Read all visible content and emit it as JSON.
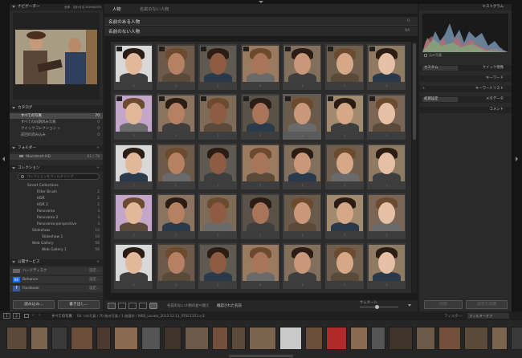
{
  "left_panel": {
    "navigator": {
      "title": "ナビゲーター",
      "modes": [
        "全体",
        "合わせる",
        "100%",
        "300%"
      ]
    },
    "catalog": {
      "title": "カタログ",
      "items": [
        {
          "label": "すべての写真",
          "count": "70",
          "selected": true
        },
        {
          "label": "すべての同期済み写真",
          "count": "0"
        },
        {
          "label": "クイックコレクション +",
          "count": "0"
        },
        {
          "label": "前回の読み込み",
          "count": "0"
        }
      ]
    },
    "folders": {
      "title": "フォルダー",
      "drive": {
        "label": "Macintosh HD",
        "size": "61 / 78"
      }
    },
    "collections": {
      "title": "コレクション",
      "filter_placeholder": "コレクションをフィルタリング",
      "items": [
        {
          "label": "Smart Collections",
          "count": ""
        },
        {
          "label": "Filter Brush",
          "count": "2"
        },
        {
          "label": "HDR",
          "count": "2"
        },
        {
          "label": "HDR 2",
          "count": "2"
        },
        {
          "label": "Panorama",
          "count": "3"
        },
        {
          "label": "Panorama 2",
          "count": "3"
        },
        {
          "label": "Panorama-perspective",
          "count": "3"
        },
        {
          "label": "Slideshow",
          "count": "10"
        },
        {
          "label": "Slideshow 1",
          "count": "16"
        },
        {
          "label": "Web Gallery",
          "count": "56"
        },
        {
          "label": "Web Gallery 1",
          "count": "56"
        }
      ]
    },
    "publish": {
      "title": "公開サービス",
      "items": [
        {
          "label": "ハードディスク",
          "action": "設定..."
        },
        {
          "label": "Behance",
          "action": "設定..."
        },
        {
          "label": "Facebook",
          "action": "設定..."
        }
      ]
    },
    "import_button": "読み込み...",
    "export_button": "書き出し..."
  },
  "center": {
    "tabs": [
      "人物",
      "名前のない人物"
    ],
    "header1": {
      "label": "名前のある人物",
      "count": "0"
    },
    "header2": {
      "label": "名前のない人物",
      "count": "64"
    },
    "toolbar": {
      "sort_label": "名前のない人物の並べ替え",
      "sort_value": "確認された名前",
      "thumb_label": "サムネール"
    }
  },
  "right_panel": {
    "histogram_title": "ヒストグラム",
    "info": [
      "ISO 800",
      "55 mm",
      "f / 5.6",
      "1/160 秒"
    ],
    "original_photo": "元の写真",
    "quick_develop_preset": "カスタム",
    "quick_develop": "クイック現像",
    "keywording": "キーワード",
    "keyword_list": "キーワードリスト",
    "metadata_preset": "初期設定",
    "metadata": "メタデータ",
    "comments": "コメント",
    "sync": "同期",
    "sync_settings": "設定を同期"
  },
  "filmstrip": {
    "page_buttons": [
      "1",
      "2"
    ],
    "path": "すべての写真",
    "info": "64 つの写真 / 70 枚の写真 / 1 枚選択 / WEB_Lovato_2013.12.11_RTSC1153.cr2",
    "filter_label": "フィルター:",
    "filter_value": "フィルターオフ"
  },
  "colors": {
    "accent": "#8ab0d8",
    "panel": "#2a2a2a",
    "selection": "#4a4a4a"
  }
}
